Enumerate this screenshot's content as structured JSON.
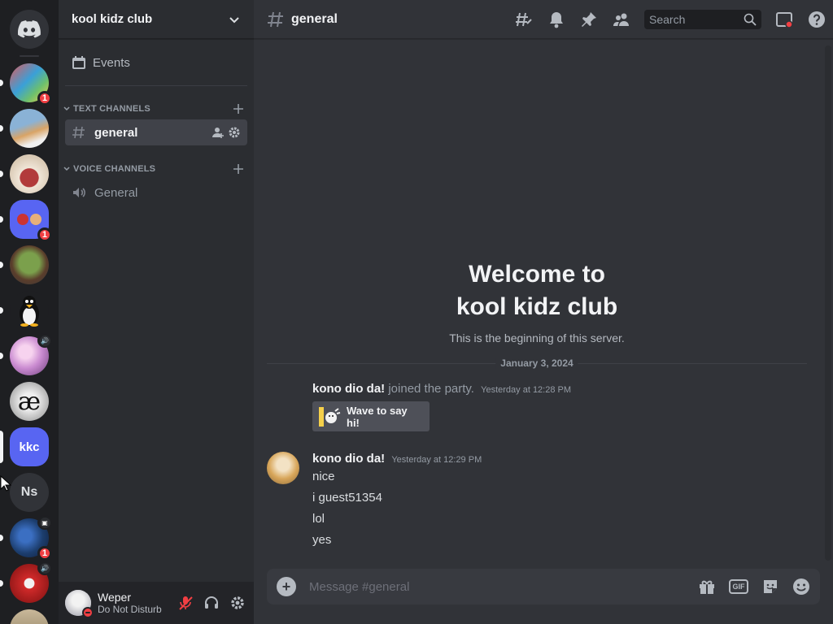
{
  "server_rail": {
    "home_icon": "discord-logo-icon",
    "servers": [
      {
        "name": "server-colorful",
        "badge": "1",
        "unread": true,
        "color": "#3a8fb8"
      },
      {
        "name": "server-cat-piano",
        "badge": "",
        "unread": true,
        "color": "#8ab2d6"
      },
      {
        "name": "server-red-face",
        "badge": "",
        "unread": true,
        "color": "#d0c8c4"
      },
      {
        "name": "server-collage",
        "badge": "1",
        "unread": true,
        "color": "#5865f2"
      },
      {
        "name": "server-green-frog",
        "badge": "",
        "unread": true,
        "color": "#6f8a4c"
      },
      {
        "name": "server-penguin",
        "badge": "",
        "unread": true,
        "color": "#1e1f22"
      },
      {
        "name": "server-anime-pink",
        "badge": "",
        "unread": true,
        "color": "#d7a4d8",
        "mini": "speaker-icon"
      },
      {
        "name": "server-ae",
        "badge": "",
        "unread": false,
        "color": "#d8d8d8",
        "text": "æ"
      },
      {
        "name": "server-kkc",
        "badge": "",
        "unread": false,
        "active": true,
        "color": "#5865f2",
        "text": "kkc"
      },
      {
        "name": "server-ns",
        "badge": "",
        "unread": false,
        "color": "#313338",
        "text": "Ns"
      },
      {
        "name": "server-dark-blue",
        "badge": "1",
        "unread": true,
        "color": "#1c3d6d",
        "mini": "calendar-icon"
      },
      {
        "name": "server-red-robot",
        "badge": "",
        "unread": true,
        "color": "#d12a2a",
        "mini": "speaker-icon"
      }
    ]
  },
  "sidebar": {
    "guild_name": "kool kidz club",
    "events_label": "Events",
    "categories": [
      {
        "label": "TEXT CHANNELS",
        "channels": [
          {
            "name": "general",
            "type": "text",
            "active": true
          }
        ]
      },
      {
        "label": "VOICE CHANNELS",
        "channels": [
          {
            "name": "General",
            "type": "voice",
            "active": false
          }
        ]
      }
    ]
  },
  "user_panel": {
    "username": "Weper",
    "status": "Do Not Disturb",
    "status_color": "#f23f43"
  },
  "header": {
    "channel_name": "general",
    "search_placeholder": "Search"
  },
  "chat": {
    "welcome_line1": "Welcome to",
    "welcome_line2": "kool kidz club",
    "welcome_sub": "This is the beginning of this server.",
    "date_divider": "January 3, 2024",
    "join_message": {
      "author": "kono dio da!",
      "text": "joined the party.",
      "timestamp": "Yesterday at 12:28 PM",
      "wave_button": "Wave to say hi!"
    },
    "message": {
      "author": "kono dio da!",
      "timestamp": "Yesterday at 12:29 PM",
      "lines": [
        "nice",
        "i guest51354",
        "lol",
        "yes"
      ]
    },
    "composer_placeholder": "Message #general"
  },
  "colors": {
    "accent": "#5865f2",
    "danger": "#f23f43",
    "bg_main": "#313338",
    "bg_sidebar": "#2b2d31"
  }
}
